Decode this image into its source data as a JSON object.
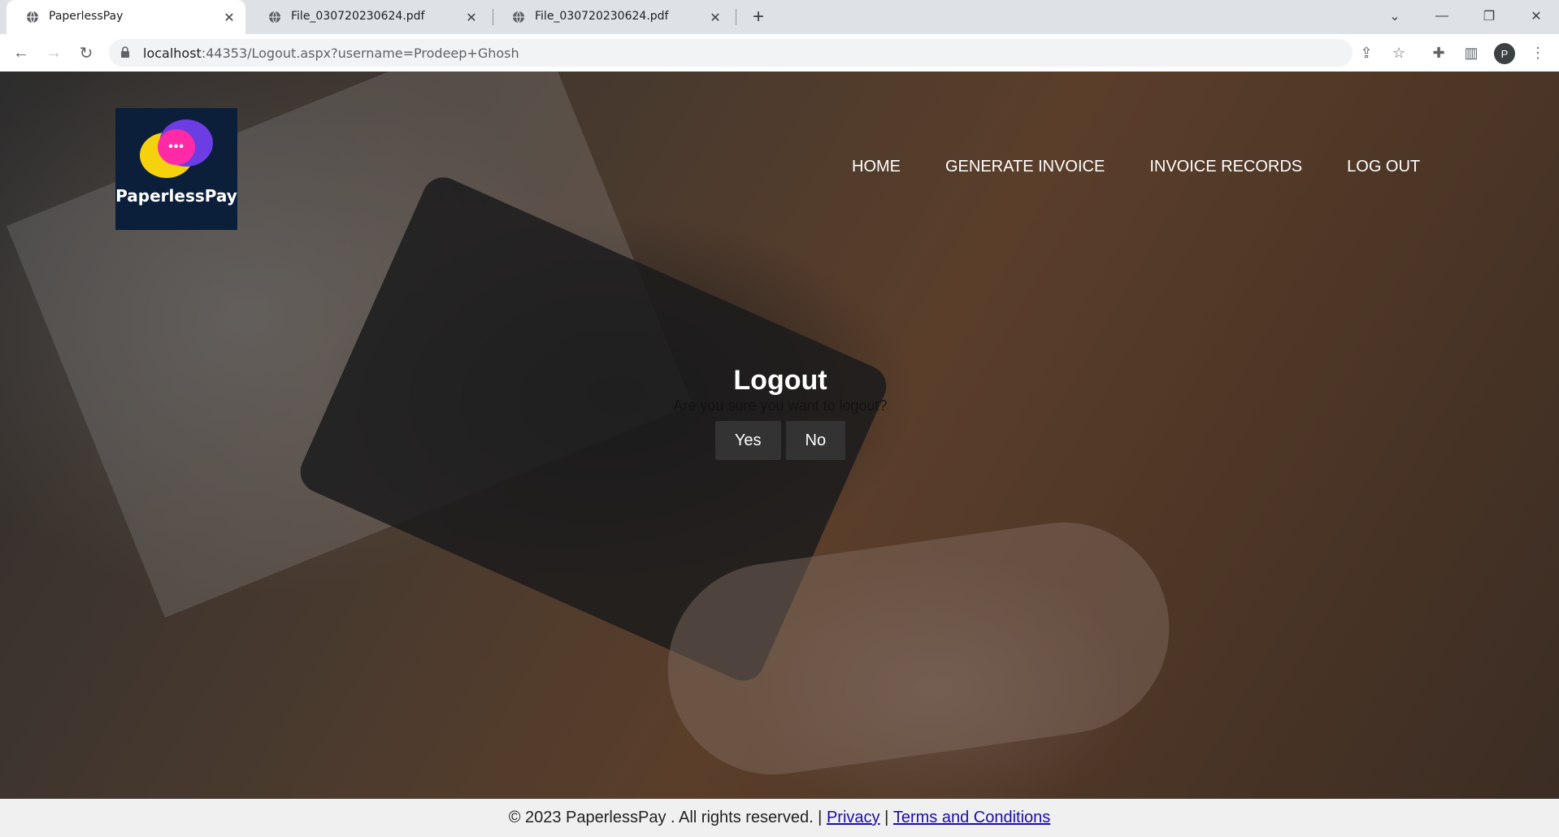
{
  "browser": {
    "tabs": [
      {
        "label": "PaperlessPay",
        "active": true
      },
      {
        "label": "File_030720230624.pdf",
        "active": false
      },
      {
        "label": "File_030720230624.pdf",
        "active": false
      }
    ],
    "url_host": "localhost",
    "url_rest": ":44353/Logout.aspx?username=Prodeep+Ghosh",
    "profile_initial": "P",
    "icons": {
      "new_tab": "plus-icon",
      "tab_close": "close-icon",
      "back": "back-arrow-icon",
      "forward": "forward-arrow-icon",
      "reload": "reload-icon",
      "lock": "lock-icon",
      "share": "share-icon",
      "bookmark": "star-icon",
      "extensions": "puzzle-icon",
      "side_panel": "side-panel-icon",
      "menu": "kebab-menu-icon"
    }
  },
  "site": {
    "logo_text": "PaperlessPay",
    "logo_dots": "•••",
    "nav": [
      "HOME",
      "GENERATE INVOICE",
      "INVOICE RECORDS",
      "LOG OUT"
    ]
  },
  "dialog": {
    "title": "Logout",
    "message": "Are you sure you want to logout?",
    "yes_label": "Yes",
    "no_label": "No"
  },
  "footer": {
    "copyright": "© 2023 PaperlessPay . All rights reserved. |",
    "privacy": "Privacy",
    "separator": "|",
    "terms": "Terms and Conditions"
  },
  "colors": {
    "logo_bg": "#0b1f3a",
    "button_bg": "#333333",
    "footer_bg": "#f0f0f0",
    "link": "#1a0dab"
  }
}
